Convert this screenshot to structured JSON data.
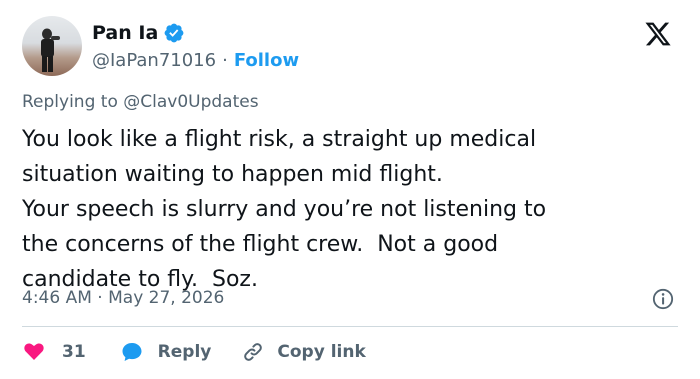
{
  "author": {
    "name": "Pan Ia",
    "handle": "@IaPan71016",
    "separator": "·",
    "follow_label": "Follow",
    "verified_color": "#1d9bf0"
  },
  "reply_context": {
    "prefix": "Replying to ",
    "mention": "@Clav0Updates"
  },
  "tweet": {
    "text": "You look like a flight risk, a straight up medical\nsituation waiting to happen mid flight.\nYour speech is slurry and you’re not listening to\nthe concerns of the flight crew.  Not a good\ncandidate to fly.  Soz.",
    "time": "4:46 AM",
    "date_separator": " · ",
    "date": "May 27, 2026"
  },
  "actions": {
    "like_count": "31",
    "reply_label": "Reply",
    "copy_label": "Copy link"
  },
  "colors": {
    "like": "#f91880",
    "reply": "#1d9bf0",
    "link": "#1d9bf0",
    "muted": "#536471"
  },
  "icons": [
    "verified-badge-icon",
    "x-logo-icon",
    "info-icon",
    "heart-icon",
    "reply-bubble-icon",
    "link-icon"
  ]
}
